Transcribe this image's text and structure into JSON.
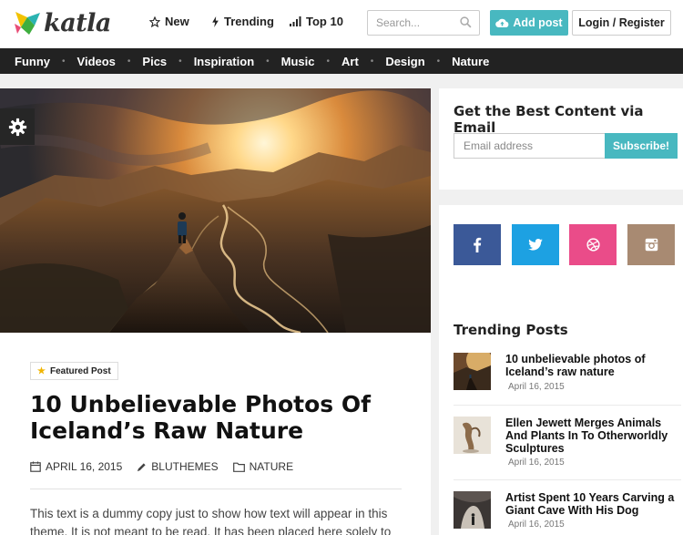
{
  "brand": {
    "name": "katla"
  },
  "topnav": {
    "new": "New",
    "trending": "Trending",
    "top10": "Top 10"
  },
  "search": {
    "placeholder": "Search..."
  },
  "header_buttons": {
    "add_post": "Add post",
    "login": "Login / Register"
  },
  "categories": [
    "Funny",
    "Videos",
    "Pics",
    "Inspiration",
    "Music",
    "Art",
    "Design",
    "Nature"
  ],
  "article": {
    "badge": "Featured Post",
    "title": "10 Unbelievable Photos Of Iceland’s Raw Nature",
    "date": "APRIL 16, 2015",
    "author": "BLUTHEMES",
    "category": "NATURE",
    "excerpt": "This text is a dummy copy just to show how text will appear in this theme. It is not meant to be read. It has been placed here solely to"
  },
  "newsletter": {
    "heading": "Get the Best Content via Email",
    "placeholder": "Email address",
    "button": "Subscribe!"
  },
  "social": [
    {
      "icon": "facebook-icon",
      "color": "#3b5998"
    },
    {
      "icon": "twitter-icon",
      "color": "#1da1e2"
    },
    {
      "icon": "dribbble-icon",
      "color": "#ea4c89"
    },
    {
      "icon": "instagram-icon",
      "color": "#a88a72"
    }
  ],
  "trending": {
    "heading": "Trending Posts",
    "posts": [
      {
        "title": "10 unbelievable photos of Iceland’s raw nature",
        "date": "April 16, 2015"
      },
      {
        "title": "Ellen Jewett Merges Animals And Plants In To Otherworldly Sculptures",
        "date": "April 16, 2015"
      },
      {
        "title": "Artist Spent 10 Years Carving a Giant Cave With His Dog",
        "date": "April 16, 2015"
      }
    ]
  },
  "colors": {
    "accent": "#48b8c0",
    "nav_bg": "#222222",
    "page_bg": "#f0f0f0"
  }
}
